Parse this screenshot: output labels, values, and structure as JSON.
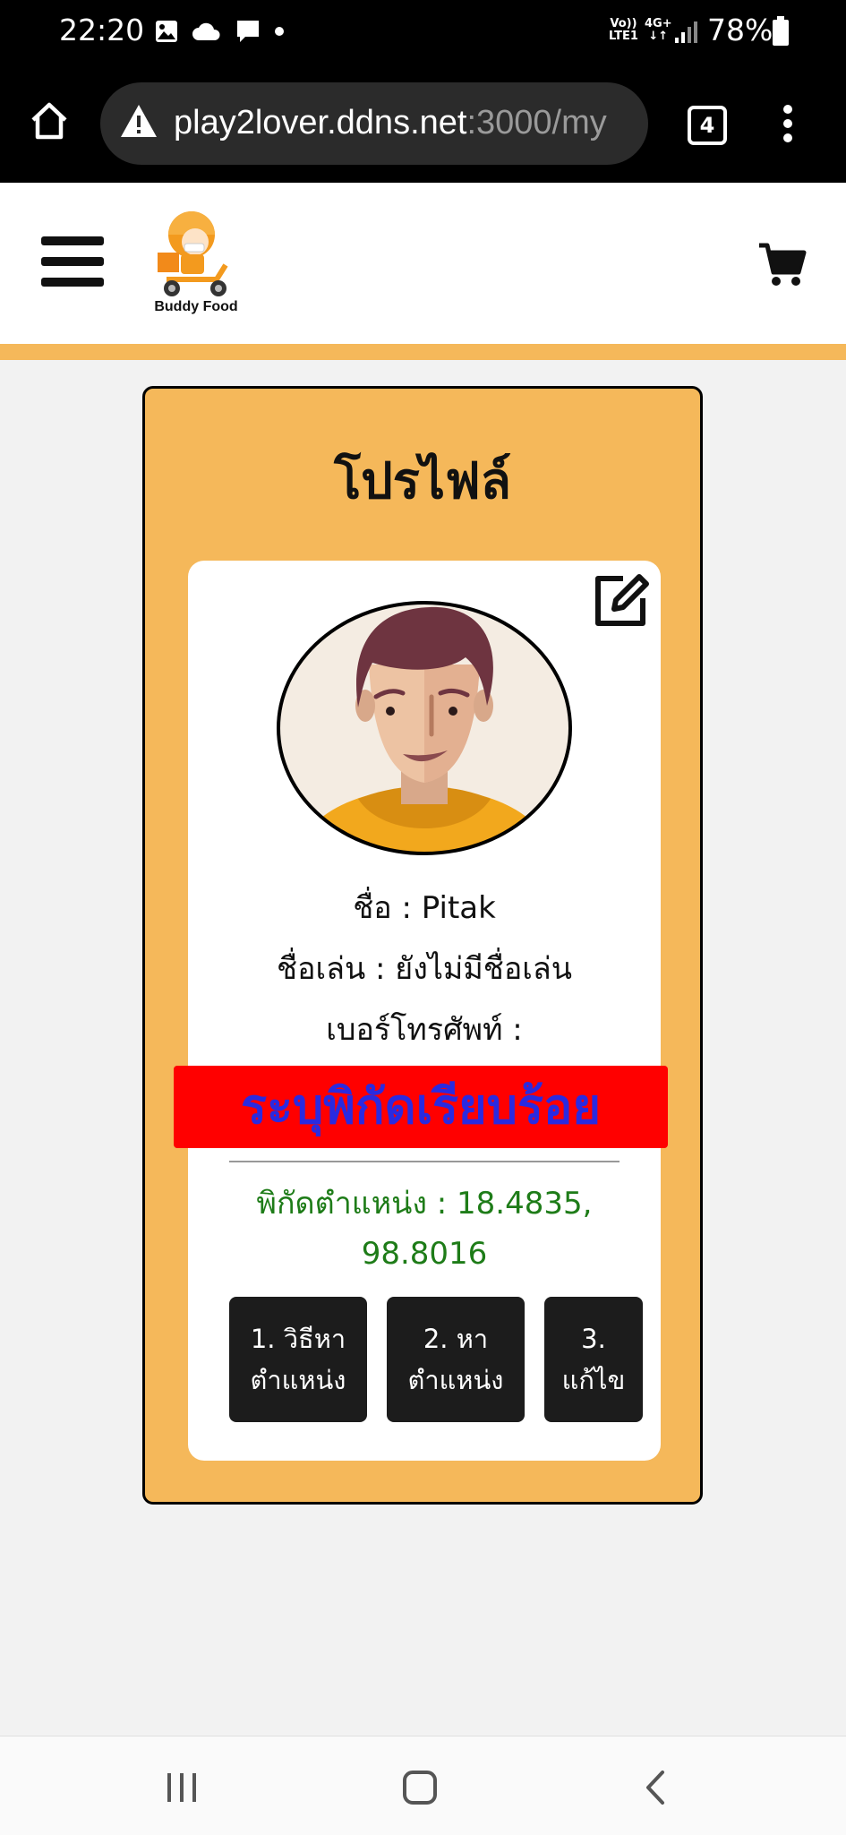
{
  "status_bar": {
    "time": "22:20",
    "notification_icons": [
      "image-icon",
      "cloud-icon",
      "message-icon",
      "dot-icon"
    ],
    "network_left_top": "Vo))",
    "network_left_bottom": "LTE1",
    "network_right_top": "4G+",
    "network_right_bottom": "↓↑",
    "battery": "78%"
  },
  "browser": {
    "url_host": "play2lover.ddns.net",
    "url_path": ":3000/my",
    "tab_count": "4"
  },
  "header": {
    "logo_text": "Buddy Food"
  },
  "profile": {
    "title": "โปรไฟล์",
    "name_line": "ชื่อ : Pitak",
    "nickname_line": "ชื่อเล่น : ยังไม่มีชื่อเล่น",
    "phone_line": "เบอร์โทรศัพท์ :",
    "coords_line1": "พิกัดตำแหน่ง : 18.4835,",
    "coords_line2": "98.8016",
    "buttons": [
      {
        "line1": "1. วิธีหา",
        "line2": "ตำแหน่ง"
      },
      {
        "line1": "2. หา",
        "line2": "ตำแหน่ง"
      },
      {
        "line1": "3.",
        "line2": "แก้ไข"
      }
    ]
  },
  "toast": {
    "message": "ระบุพิกัดเรียบร้อย"
  },
  "colors": {
    "accent_orange": "#f5b85a",
    "coords_green": "#1e7c18",
    "toast_red": "#ff0000",
    "toast_text_blue": "#2a2ae0"
  }
}
